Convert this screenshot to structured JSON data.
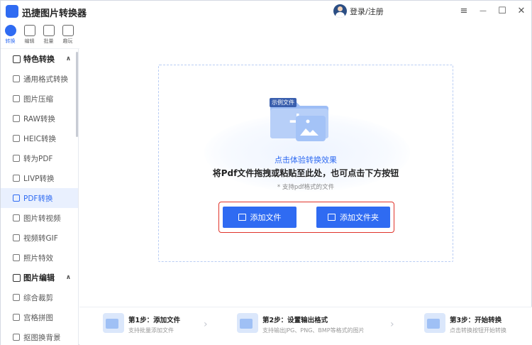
{
  "app": {
    "title": "迅捷图片转换器",
    "accent": "#2f6bf2"
  },
  "user": {
    "login_label": "登录/注册"
  },
  "window_controls": {
    "menu": "≡",
    "minimize": "—",
    "maximize": "☐",
    "close": "✕"
  },
  "rail": [
    {
      "label": "转换",
      "icon": "convert-icon",
      "active": true
    },
    {
      "label": "编辑",
      "icon": "edit-icon",
      "active": false
    },
    {
      "label": "批量",
      "icon": "batch-icon",
      "active": false
    },
    {
      "label": "趣玩",
      "icon": "fun-icon",
      "active": false
    }
  ],
  "sidebar": {
    "group1": {
      "label": "特色转换",
      "chevron": "∧"
    },
    "items": [
      {
        "label": "通用格式转换"
      },
      {
        "label": "图片压缩"
      },
      {
        "label": "RAW转换"
      },
      {
        "label": "HEIC转换"
      },
      {
        "label": "转为PDF"
      },
      {
        "label": "LIVP转换"
      },
      {
        "label": "PDF转换",
        "active": true
      },
      {
        "label": "图片转视频"
      },
      {
        "label": "视频转GIF"
      },
      {
        "label": "照片特效"
      }
    ],
    "group2": {
      "label": "图片编辑",
      "chevron": "∧"
    },
    "items2": [
      {
        "label": "综合裁剪"
      },
      {
        "label": "宫格拼图"
      },
      {
        "label": "抠图换背景"
      }
    ]
  },
  "dropzone": {
    "sample_tag": "示例文件",
    "try_link": "点击体验转换效果",
    "main_hint": "将Pdf文件拖拽或粘贴至此处，也可点击下方按钮",
    "sub_hint": "* 支持pdf格式的文件",
    "add_file": "添加文件",
    "add_folder": "添加文件夹"
  },
  "steps": [
    {
      "title": "第1步：添加文件",
      "desc": "支持批量添加文件"
    },
    {
      "title": "第2步：设置输出格式",
      "desc": "支持输出JPG、PNG、BMP等格式的图片"
    },
    {
      "title": "第3步：开始转换",
      "desc": "点击转换按钮开始转换"
    }
  ]
}
